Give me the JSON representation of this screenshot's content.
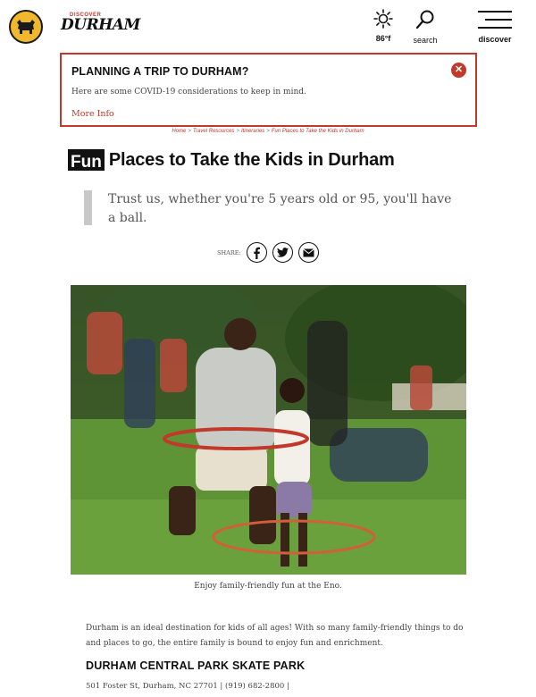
{
  "header": {
    "brand_small": "DISCOVER",
    "brand_big": "DURHAM",
    "weather_temp": "86°f",
    "search_label": "search",
    "discover_label": "discover",
    "icons": {
      "logo": "bull-logo-icon",
      "weather": "sun-icon",
      "search": "search-icon",
      "menu": "hamburger-menu-icon"
    }
  },
  "alert": {
    "title": "PLANNING A TRIP TO DURHAM?",
    "text": "Here are some COVID-19 considerations to keep in mind.",
    "link": "More Info",
    "close_icon": "close-icon"
  },
  "breadcrumb": {
    "items": [
      "Home",
      "Travel Resources",
      "Itineraries",
      "Fun Places to Take the Kids in Durham"
    ],
    "separator": ">"
  },
  "article": {
    "title_highlight": "Fun",
    "title_rest": "Places to Take the Kids in Durham",
    "quote": "Trust us, whether you're 5 years old or 95, you'll have a ball.",
    "share_label": "SHARE:",
    "share_icons": [
      "facebook-icon",
      "twitter-icon",
      "email-icon"
    ],
    "caption": "Enjoy family-friendly fun at the Eno.",
    "intro": "Durham is an ideal destination for kids of all ages! With so many family-friendly things to do and places to go, the entire family is bound to enjoy fun and enrichment.",
    "section_title": "DURHAM CENTRAL PARK SKATE PARK",
    "address": "501 Foster St, Durham, NC 27701 | (919) 682-2800 |"
  },
  "colors": {
    "accent": "#c0392b",
    "logo_bg": "#f1b82d",
    "quote_bar": "#c8c8c8"
  }
}
